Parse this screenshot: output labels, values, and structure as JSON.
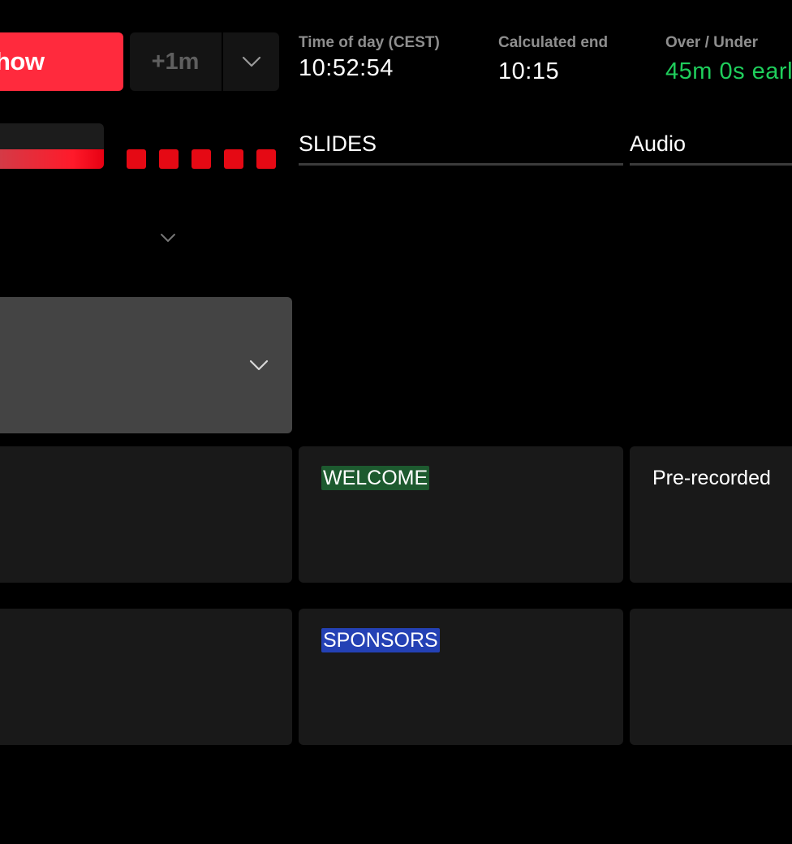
{
  "toolbar": {
    "show_label": "how",
    "add_time_label": "+1m",
    "colors": {
      "show_button": "#ff2a3d",
      "over_under_value": "#1fce5c"
    }
  },
  "stats": {
    "time_of_day": {
      "label": "Time of day (CEST)",
      "value": "10:52:54"
    },
    "calculated_end": {
      "label": "Calculated end",
      "value": "10:15"
    },
    "over_under": {
      "label": "Over / Under",
      "value": "45m 0s earl"
    }
  },
  "progress": {
    "fraction": 1.0,
    "segments_visible": 5
  },
  "columns": [
    {
      "label": "SLIDES"
    },
    {
      "label": "Audio"
    }
  ],
  "rows": [
    {
      "slides": {
        "tag": "WELCOME",
        "tag_color": "#1d5a2f"
      },
      "audio": {
        "text": "Pre-recorded"
      }
    },
    {
      "slides": {
        "tag": "SPONSORS",
        "tag_color": "#2441b5"
      },
      "audio": {
        "text": ""
      }
    }
  ],
  "icons": {
    "add_time_menu": "chevron-down-icon",
    "collapse_section": "chevron-down-icon",
    "dropdown": "chevron-down-icon"
  }
}
